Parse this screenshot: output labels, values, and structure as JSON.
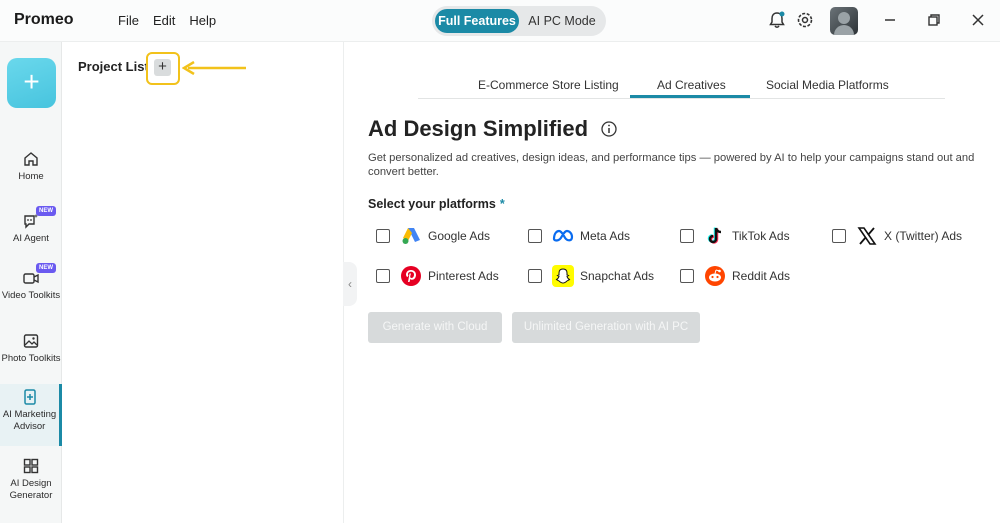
{
  "app": {
    "name": "Promeo",
    "menu": [
      "File",
      "Edit",
      "Help"
    ],
    "mode_active": "Full Features",
    "mode_inactive": "AI PC Mode"
  },
  "rail": {
    "create_label": "+",
    "items": [
      {
        "label": "Home",
        "icon": "home-icon"
      },
      {
        "label": "AI Agent",
        "icon": "ai-agent-icon",
        "badge": "NEW"
      },
      {
        "label": "Video Toolkits",
        "icon": "video-icon",
        "badge": "NEW"
      },
      {
        "label": "Photo Toolkits",
        "icon": "photo-icon"
      },
      {
        "label": "AI Marketing Advisor",
        "icon": "marketing-advisor-icon",
        "active": true
      },
      {
        "label": "AI Design Generator",
        "icon": "design-generator-icon"
      }
    ]
  },
  "project_panel": {
    "title": "Project List",
    "add_label": "+"
  },
  "main": {
    "tabs": [
      "E-Commerce Store Listing",
      "Ad Creatives",
      "Social Media Platforms"
    ],
    "active_tab": "Ad Creatives",
    "headline": "Ad Design Simplified",
    "description": "Get personalized ad creatives, design ideas, and performance tips — powered by AI to help your campaigns stand out and convert better.",
    "platforms_label": "Select your platforms",
    "required_mark": "*",
    "platforms": [
      {
        "label": "Google Ads",
        "icon": "google-ads-icon"
      },
      {
        "label": "Meta Ads",
        "icon": "meta-icon"
      },
      {
        "label": "TikTok Ads",
        "icon": "tiktok-icon"
      },
      {
        "label": "X (Twitter) Ads",
        "icon": "x-icon"
      },
      {
        "label": "Pinterest Ads",
        "icon": "pinterest-icon"
      },
      {
        "label": "Snapchat Ads",
        "icon": "snapchat-icon"
      },
      {
        "label": "Reddit Ads",
        "icon": "reddit-icon"
      }
    ],
    "generate_cloud": "Generate with Cloud",
    "generate_local": "Unlimited Generation with AI PC"
  },
  "colors": {
    "accent": "#1b8aa6",
    "highlight": "#f2c21b",
    "create_button": "#52cbe3"
  }
}
